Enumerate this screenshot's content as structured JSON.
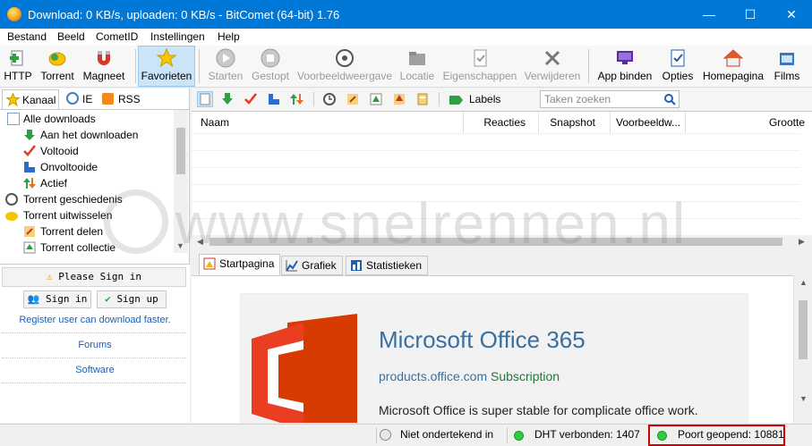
{
  "window": {
    "title": "Download: 0 KB/s, uploaden: 0 KB/s - BitComet (64-bit) 1.76",
    "minimize": "—",
    "maximize": "☐",
    "close": "✕"
  },
  "menu": [
    "Bestand",
    "Beeld",
    "CometID",
    "Instellingen",
    "Help"
  ],
  "toolbar": {
    "http": "HTTP",
    "torrent": "Torrent",
    "magnet": "Magneet",
    "favorites": "Favorieten",
    "start": "Starten",
    "stop": "Gestopt",
    "preview": "Voorbeeldweergave",
    "location": "Locatie",
    "properties": "Eigenschappen",
    "delete": "Verwijderen",
    "appbind": "App binden",
    "options": "Opties",
    "homepage": "Homepagina",
    "movies": "Films"
  },
  "left": {
    "tabs": [
      "Kanaal",
      "IE",
      "RSS"
    ],
    "tree": [
      {
        "label": "Alle downloads",
        "icon": "document-icon"
      },
      {
        "label": "Aan het downloaden",
        "icon": "down-arrow-icon"
      },
      {
        "label": "Voltooid",
        "icon": "checkmark-icon"
      },
      {
        "label": "Onvoltooide",
        "icon": "blocks-icon"
      },
      {
        "label": "Actief",
        "icon": "updown-arrows-icon"
      },
      {
        "label": "Torrent geschiedenis",
        "icon": "clock-icon"
      },
      {
        "label": "Torrent uitwisselen",
        "icon": "folder-icon"
      },
      {
        "label": "Torrent delen",
        "icon": "share-icon"
      },
      {
        "label": "Torrent collectie",
        "icon": "collection-icon"
      }
    ],
    "signin": {
      "notice": "Please Sign in",
      "signin_btn": "Sign in",
      "signup_btn": "Sign up"
    },
    "links": [
      "Register user can download faster.",
      "Forums",
      "Software"
    ]
  },
  "rtoolbar": {
    "labels": "Labels",
    "search_placeholder": "Taken zoeken"
  },
  "grid": {
    "columns": [
      "Naam",
      "Reacties",
      "Snapshot",
      "Voorbeeldw...",
      "Grootte"
    ]
  },
  "bottom_tabs": [
    "Startpagina",
    "Grafiek",
    "Statistieken"
  ],
  "ad": {
    "title": "Microsoft Office 365",
    "domain": "products.office.com",
    "sub": "Subscription",
    "text": "Microsoft Office is super stable for complicate office work."
  },
  "watermark": "www.snelrennen.nl",
  "status": {
    "signed": "Niet ondertekend in",
    "dht": "DHT verbonden: 1407",
    "port": "Poort geopend: 10881"
  },
  "colors": {
    "titlebar": "#0078d7",
    "office_red": "#d83b01",
    "ad_title": "#3b6f9e",
    "highlight": "#d40000",
    "status_green": "#2ecc40"
  }
}
